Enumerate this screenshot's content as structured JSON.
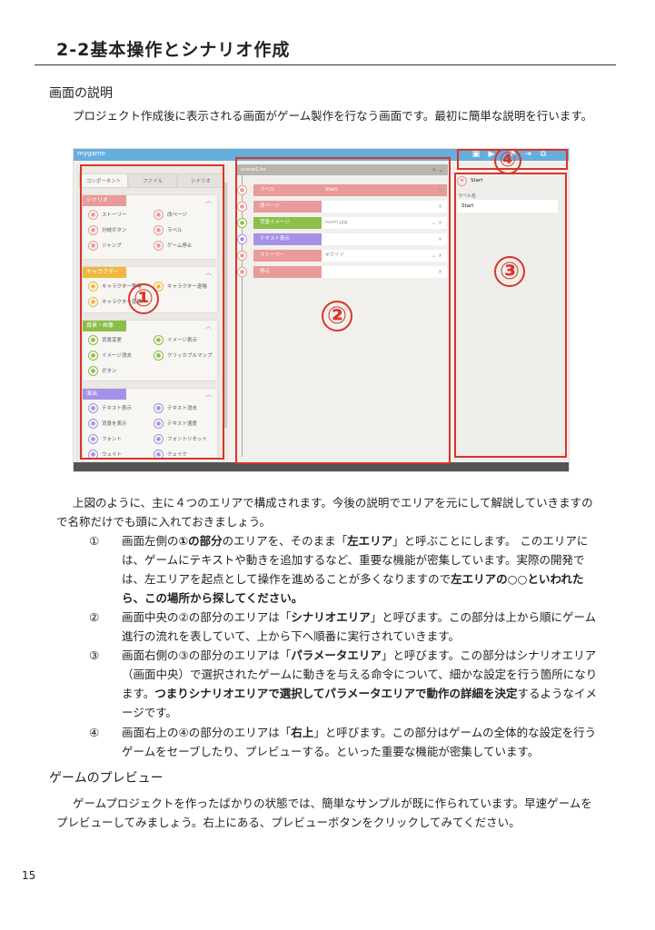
{
  "heading": "2-2基本操作とシナリオ作成",
  "section1": "画面の説明",
  "intro": "プロジェクト作成後に表示される画面がゲーム製作を行なう画面です。最初に簡単な説明を行います。",
  "app": {
    "name": "mygame",
    "tabs": [
      "コンポーネント",
      "ファイル",
      "シナリオ"
    ],
    "sections": [
      {
        "title": "シナリオ",
        "color": "#e99a9a",
        "items": [
          "ストーリー",
          "改ページ",
          "分岐ボタン",
          "ラベル",
          "ジャンプ",
          "ゲーム停止"
        ]
      },
      {
        "title": "キャラクター",
        "color": "#efb73e",
        "items": [
          "キャラクター登場",
          "キャラクター退場",
          "キャラクター変更"
        ]
      },
      {
        "title": "背景・画像",
        "color": "#8cbf4a",
        "items": [
          "背景変更",
          "イメージ表示",
          "イメージ消去",
          "クリッカブルマップ",
          "ボタン"
        ]
      },
      {
        "title": "演出",
        "color": "#a592e8",
        "items": [
          "テキスト表示",
          "テキスト消去",
          "背景を表示",
          "テキスト速度",
          "フォント",
          "フォントリセット",
          "ウェイト",
          "クェイク"
        ]
      }
    ],
    "file": "scene1.ks",
    "rows": [
      {
        "label": "ラベル",
        "value": "Start",
        "color": "#e99a9a",
        "dropdown": false
      },
      {
        "label": "改ページ",
        "value": "",
        "color": "#e99a9a",
        "dropdown": false
      },
      {
        "label": "背景イメージ",
        "value": "room.jpg",
        "color": "#8cbf4a",
        "dropdown": true
      },
      {
        "label": "テキスト表示",
        "value": "",
        "color": "#a592e8",
        "dropdown": false
      },
      {
        "label": "ストーリー",
        "value": "#ガイド",
        "color": "#e99a9a",
        "dropdown": true
      },
      {
        "label": "停止",
        "value": "",
        "color": "#e99a9a",
        "dropdown": false
      }
    ],
    "param": {
      "title": "Start",
      "field_label": "ラベル名",
      "field_value": "Start"
    },
    "markers": [
      "①",
      "②",
      "③",
      "④"
    ]
  },
  "para1_a": "上図のように、主に４つのエリアで構成されます。今後の説明でエリアを元にして解説していきますの",
  "para1_b": "で名称だけでも頭に入れておきましょう。",
  "list": [
    {
      "num": "①",
      "l1a": "画面左側の",
      "l1b": "①の部分",
      "l1c": "のエリアを、そのまま「",
      "l1d": "左エリア",
      "l1e": "」と呼ぶことにします。 このエリアに",
      "l2": "は、ゲームにテキストや動きを追加するなど、重要な機能が密集しています。実際の開発で",
      "l3a": "は、左エリアを起点として操作を進めることが多くなりますので",
      "l3b": "左エリアの○○といわれた",
      "l4": "ら、この場所から探してください。"
    },
    {
      "num": "②",
      "l1a": "画面中央の②の部分のエリアは「",
      "l1b": "シナリオエリア",
      "l1c": "」と呼びます。この部分は上から順にゲーム",
      "l2": "進行の流れを表していて、上から下へ順番に実行されていきます。"
    },
    {
      "num": "③",
      "l1a": "画面右側の③の部分のエリアは「",
      "l1b": "パラメータエリア",
      "l1c": "」と呼びます。この部分はシナリオエリア",
      "l2": "（画面中央）で選択されたゲームに動きを与える命令について、細かな設定を行う箇所になり",
      "l3a": "ます。",
      "l3b": "つまりシナリオエリアで選択してパラメータエリアで動作の詳細を決定",
      "l3c": "するようなイメ",
      "l4": "ージです。"
    },
    {
      "num": "④",
      "l1a": "画面右上の④の部分のエリアは「",
      "l1b": "右上",
      "l1c": "」と呼びます。この部分はゲームの全体的な設定を行う",
      "l2": "ゲームをセーブしたり、プレビューする。といった重要な機能が密集しています。"
    }
  ],
  "section2": "ゲームのプレビュー",
  "para2_a": "ゲームプロジェクトを作ったばかりの状態では、簡単なサンプルが既に作られています。早速ゲームを",
  "para2_b": "プレビューしてみましょう。右上にある、プレビューボタンをクリックしてみてください。",
  "page_number": "15"
}
